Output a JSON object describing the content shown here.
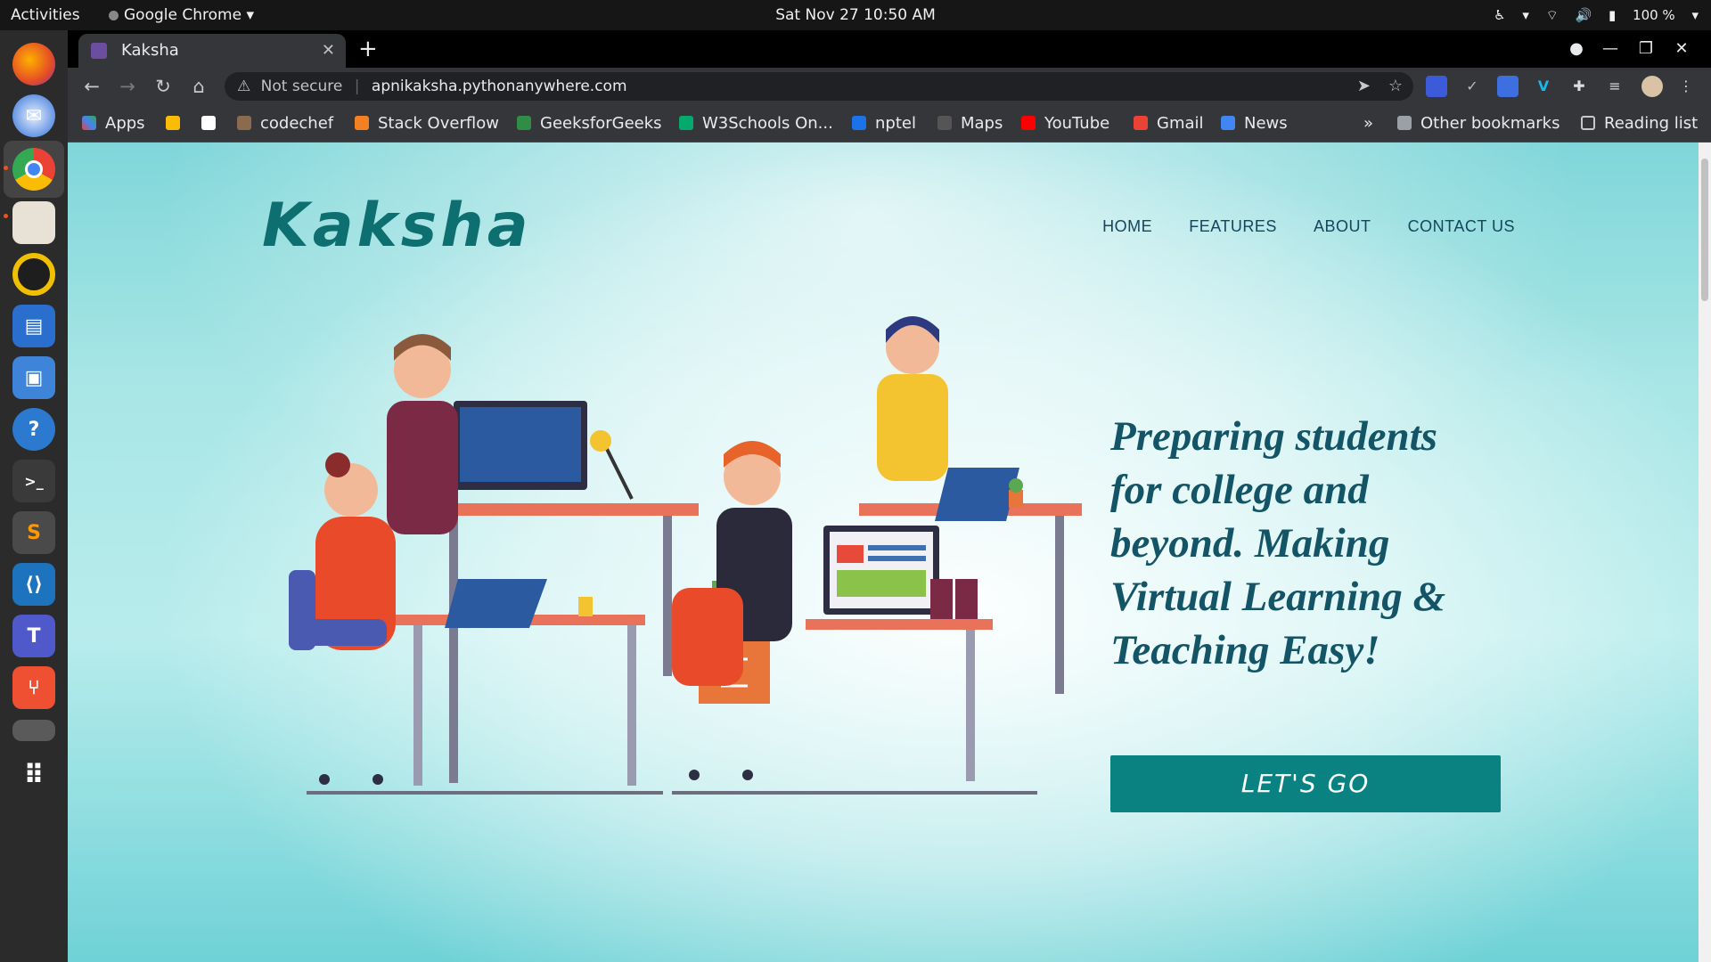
{
  "topbar": {
    "activities": "Activities",
    "app_name": "Google Chrome",
    "clock": "Sat Nov 27  10:50 AM",
    "battery": "100 %"
  },
  "dock": {
    "apps": [
      "firefox-icon",
      "thunderbird-icon",
      "chrome-icon",
      "files-icon",
      "rhythmbox-icon",
      "writer-icon",
      "software-icon",
      "help-icon",
      "terminal-icon",
      "sublime-icon",
      "vscode-icon",
      "teams-icon",
      "git-icon",
      "drive-icon",
      "app-grid-icon"
    ]
  },
  "browser": {
    "tab_title": "Kaksha",
    "omnibox": {
      "security": "Not secure",
      "url": "apnikaksha.pythonanywhere.com"
    },
    "bookmarks": [
      {
        "label": "Apps",
        "color": "#ea4335"
      },
      {
        "label": "",
        "color": "#34a853"
      },
      {
        "label": "",
        "color": "#ffffff"
      },
      {
        "label": "codechef",
        "color": "#8b6a4e"
      },
      {
        "label": "Stack Overflow",
        "color": "#f48024"
      },
      {
        "label": "GeeksforGeeks",
        "color": "#2f8d46"
      },
      {
        "label": "W3Schools On...",
        "color": "#04aa6d"
      },
      {
        "label": "nptel",
        "color": "#1a73e8"
      },
      {
        "label": "Maps",
        "color": "#555555"
      },
      {
        "label": "YouTube",
        "color": "#ff0000"
      },
      {
        "label": "Gmail",
        "color": "#ea4335"
      },
      {
        "label": "News",
        "color": "#4285f4"
      }
    ],
    "more_bookmarks": "»",
    "other_bookmarks": "Other bookmarks",
    "reading_list": "Reading list"
  },
  "page": {
    "logo": "Kaksha",
    "nav": [
      "HOME",
      "FEATURES",
      "ABOUT",
      "CONTACT US"
    ],
    "hero_text": "Preparing students for college and beyond. Making Virtual Learning & Teaching Easy!",
    "cta": "LET'S GO",
    "accent": "#0a8282"
  }
}
